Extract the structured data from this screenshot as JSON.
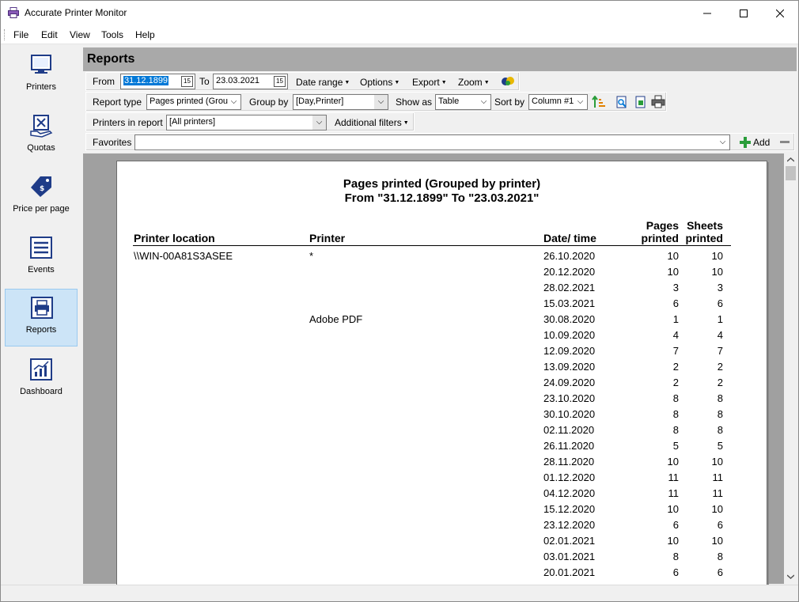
{
  "window": {
    "title": "Accurate Printer Monitor",
    "minimize": "—",
    "maximize": "☐",
    "close": "✕"
  },
  "menu": [
    "File",
    "Edit",
    "View",
    "Tools",
    "Help"
  ],
  "sidebar": [
    {
      "label": "Printers",
      "icon": "printer-monitor-icon",
      "active": false
    },
    {
      "label": "Quotas",
      "icon": "quota-icon",
      "active": false
    },
    {
      "label": "Price per page",
      "icon": "price-tag-icon",
      "active": false
    },
    {
      "label": "Events",
      "icon": "events-list-icon",
      "active": false
    },
    {
      "label": "Reports",
      "icon": "report-printer-icon",
      "active": true
    },
    {
      "label": "Dashboard",
      "icon": "dashboard-chart-icon",
      "active": false
    }
  ],
  "reports": {
    "header": "Reports",
    "from_label": "From",
    "from_value": "31.12.1899",
    "to_label": "To",
    "to_value": "23.03.2021",
    "date_range": "Date range",
    "options": "Options",
    "export": "Export",
    "zoom": "Zoom",
    "report_type_label": "Report type",
    "report_type_value": "Pages printed (Grou",
    "group_by_label": "Group by",
    "group_by_value": "[Day,Printer]",
    "show_as_label": "Show as",
    "show_as_value": "Table",
    "sort_by_label": "Sort by",
    "sort_by_value": "Column #1",
    "printers_label": "Printers in report",
    "printers_value": "[All printers]",
    "additional_filters": "Additional filters",
    "favorites_label": "Favorites",
    "favorites_value": "",
    "add_label": "Add"
  },
  "report": {
    "title_line1": "Pages printed (Grouped by printer)",
    "title_line2": "From \"31.12.1899\" To \"23.03.2021\"",
    "columns": {
      "location": "Printer location",
      "printer": "Printer",
      "datetime": "Date/ time",
      "pages_1": "Pages",
      "pages_2": "printed",
      "sheets_1": "Sheets",
      "sheets_2": "printed"
    },
    "rows": [
      {
        "location": "\\\\WIN-00A81S3ASEE",
        "printer": "*",
        "date": "26.10.2020",
        "pages": "10",
        "sheets": "10"
      },
      {
        "location": "",
        "printer": "",
        "date": "20.12.2020",
        "pages": "10",
        "sheets": "10"
      },
      {
        "location": "",
        "printer": "",
        "date": "28.02.2021",
        "pages": "3",
        "sheets": "3"
      },
      {
        "location": "",
        "printer": "",
        "date": "15.03.2021",
        "pages": "6",
        "sheets": "6"
      },
      {
        "location": "",
        "printer": "Adobe PDF",
        "date": "30.08.2020",
        "pages": "1",
        "sheets": "1"
      },
      {
        "location": "",
        "printer": "",
        "date": "10.09.2020",
        "pages": "4",
        "sheets": "4"
      },
      {
        "location": "",
        "printer": "",
        "date": "12.09.2020",
        "pages": "7",
        "sheets": "7"
      },
      {
        "location": "",
        "printer": "",
        "date": "13.09.2020",
        "pages": "2",
        "sheets": "2"
      },
      {
        "location": "",
        "printer": "",
        "date": "24.09.2020",
        "pages": "2",
        "sheets": "2"
      },
      {
        "location": "",
        "printer": "",
        "date": "23.10.2020",
        "pages": "8",
        "sheets": "8"
      },
      {
        "location": "",
        "printer": "",
        "date": "30.10.2020",
        "pages": "8",
        "sheets": "8"
      },
      {
        "location": "",
        "printer": "",
        "date": "02.11.2020",
        "pages": "8",
        "sheets": "8"
      },
      {
        "location": "",
        "printer": "",
        "date": "26.11.2020",
        "pages": "5",
        "sheets": "5"
      },
      {
        "location": "",
        "printer": "",
        "date": "28.11.2020",
        "pages": "10",
        "sheets": "10"
      },
      {
        "location": "",
        "printer": "",
        "date": "01.12.2020",
        "pages": "11",
        "sheets": "11"
      },
      {
        "location": "",
        "printer": "",
        "date": "04.12.2020",
        "pages": "11",
        "sheets": "11"
      },
      {
        "location": "",
        "printer": "",
        "date": "15.12.2020",
        "pages": "10",
        "sheets": "10"
      },
      {
        "location": "",
        "printer": "",
        "date": "23.12.2020",
        "pages": "6",
        "sheets": "6"
      },
      {
        "location": "",
        "printer": "",
        "date": "02.01.2021",
        "pages": "10",
        "sheets": "10"
      },
      {
        "location": "",
        "printer": "",
        "date": "03.01.2021",
        "pages": "8",
        "sheets": "8"
      },
      {
        "location": "",
        "printer": "",
        "date": "20.01.2021",
        "pages": "6",
        "sheets": "6"
      }
    ]
  },
  "colors": {
    "accent": "#0078d7",
    "sidebar_active": "#cce4f7",
    "preview_bg": "#a0a0a0",
    "header_bg": "#a9a9a9"
  }
}
